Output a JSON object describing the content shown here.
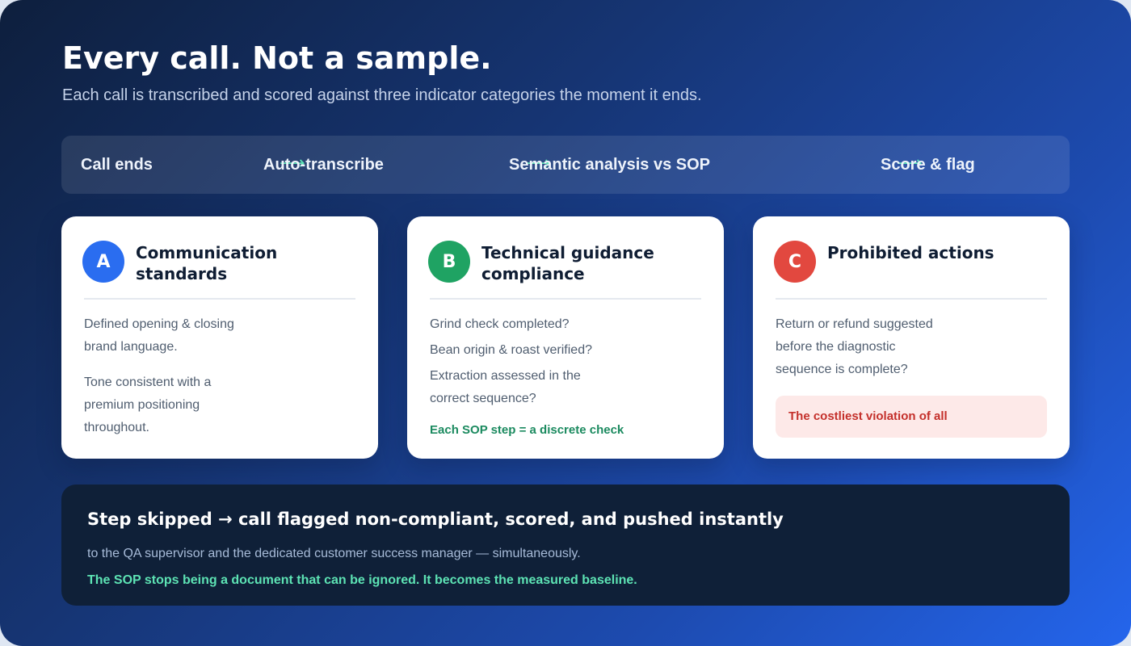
{
  "header": {
    "title": "Every call. Not a sample.",
    "subtitle": "Each call is transcribed and scored against three indicator categories the moment it ends."
  },
  "flow": {
    "arrow_glyph": "⟶",
    "steps": [
      {
        "label": "Call ends"
      },
      {
        "label": "Auto-transcribe"
      },
      {
        "label": "Semantic analysis vs SOP"
      },
      {
        "label": "Score & flag"
      }
    ]
  },
  "cards": [
    {
      "badge": "A",
      "badge_color": "#2a6df0",
      "title": "Communication standards",
      "paragraphs": [
        "Defined opening & closing brand language.",
        "Tone consistent with a premium positioning throughout."
      ]
    },
    {
      "badge": "B",
      "badge_color": "#1fa363",
      "title": "Technical guidance compliance",
      "items": [
        "Grind check completed?",
        "Bean origin & roast verified?",
        "Extraction assessed in the correct sequence?"
      ],
      "note": "Each SOP step = a discrete check",
      "note_color": "#1b8a5f"
    },
    {
      "badge": "C",
      "badge_color": "#e2483f",
      "title": "Prohibited actions",
      "paragraphs": [
        "Return or refund suggested before the diagnostic sequence is complete?"
      ],
      "alert": "The costliest violation of all",
      "alert_color": "#c4302b"
    }
  ],
  "footer": {
    "headline": "Step skipped → call flagged non-compliant, scored, and pushed instantly",
    "subline": "to the QA supervisor and the dedicated customer success manager — simultaneously.",
    "conclusion": "The SOP stops being a document that can be ignored. It becomes the measured baseline."
  },
  "colors": {
    "accent_green": "#5de3b4",
    "footer_bg": "#0f2038"
  }
}
